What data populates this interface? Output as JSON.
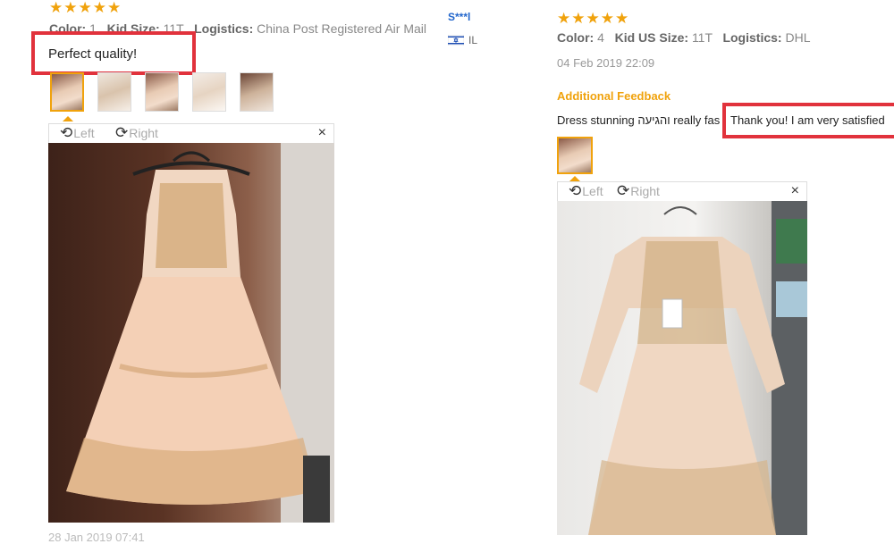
{
  "left_review": {
    "stars": "★★★★★",
    "color_label": "Color:",
    "color_value": "1",
    "size_label": "Kid Size:",
    "size_value": "11T",
    "logistics_label": "Logistics:",
    "logistics_value": "China Post Registered Air Mail",
    "comment": "Perfect quality!",
    "viewer": {
      "left_label": "Left",
      "right_label": "Right",
      "close": "×"
    },
    "date_partial": "28 Jan 2019 07:41"
  },
  "reviewer_name": "S***l",
  "reviewer_country": "IL",
  "right_review": {
    "stars": "★★★★★",
    "color_label": "Color:",
    "color_value": "4",
    "size_label": "Kid US Size:",
    "size_value": "11T",
    "logistics_label": "Logistics:",
    "logistics_value": "DHL",
    "date": "04 Feb 2019 22:09",
    "additional_label": "Additional Feedback",
    "feedback_start": "Dress stunning והגיעה really fas",
    "feedback_highlight": "Thank you! I am very satisfied",
    "viewer": {
      "left_label": "Left",
      "right_label": "Right",
      "close": "×"
    }
  },
  "colors": {
    "star": "#f0a20c",
    "accent_orange": "#f0a20c",
    "highlight_red": "#e1323c",
    "link_blue": "#2266cc"
  },
  "icons": [
    "rotate-left-icon",
    "rotate-right-icon",
    "close-icon",
    "star-icon",
    "flag-icon"
  ]
}
